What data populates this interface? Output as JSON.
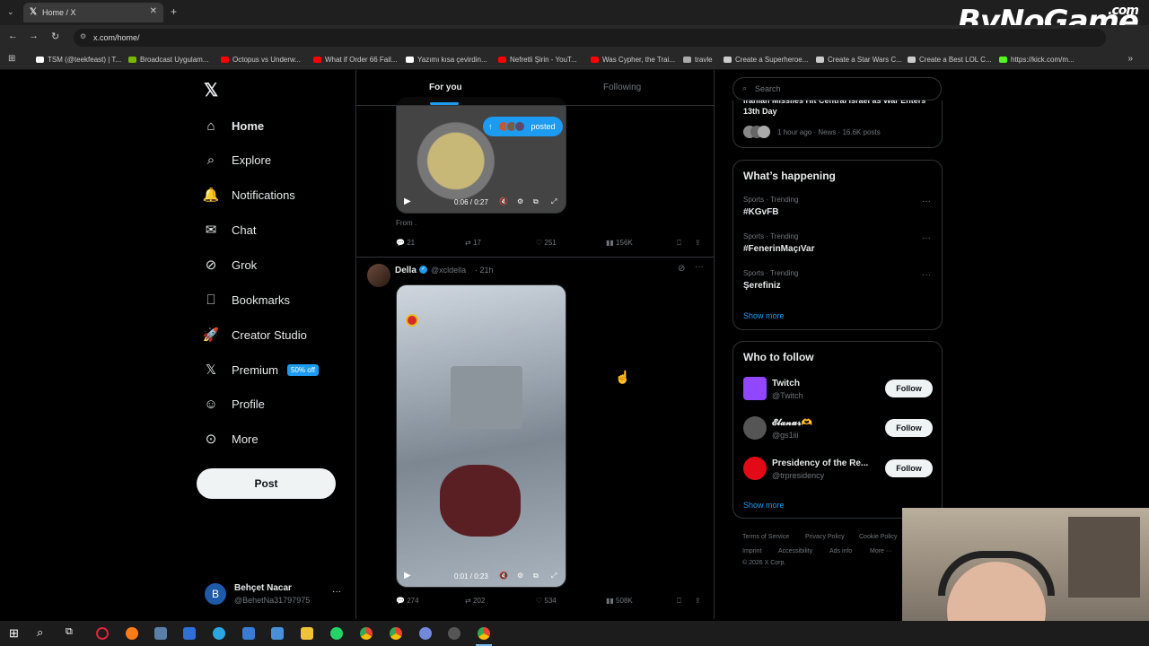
{
  "browser": {
    "tab_title": "Home / X",
    "url": "x.com/home/",
    "bookmarks": [
      {
        "label": "TSM (@teekfeast) | T...",
        "color": "#ffffff"
      },
      {
        "label": "Broadcast Uygulam...",
        "color": "#76b900"
      },
      {
        "label": "Octopus vs Underw...",
        "color": "#ff0000"
      },
      {
        "label": "What if Order 66 Fail...",
        "color": "#ff0000"
      },
      {
        "label": "Yazımı kısa çevirdin...",
        "color": "#ffffff"
      },
      {
        "label": "Nefretli Şirin - YouT...",
        "color": "#ff0000"
      },
      {
        "label": "Was Cypher, the Trai...",
        "color": "#ff0000"
      },
      {
        "label": "travle",
        "color": "#aaaaaa"
      },
      {
        "label": "Create a Superheroe...",
        "color": "#cccccc"
      },
      {
        "label": "Create a Star Wars C...",
        "color": "#cccccc"
      },
      {
        "label": "Create a Best LOL C...",
        "color": "#cccccc"
      },
      {
        "label": "https://kick.com/m...",
        "color": "#53fc18"
      }
    ],
    "watermark": "ByNoGame",
    "watermark_suffix": ".com"
  },
  "nav": {
    "logo": "X",
    "items": [
      {
        "label": "Home",
        "icon": "home-icon"
      },
      {
        "label": "Explore",
        "icon": "search-icon"
      },
      {
        "label": "Notifications",
        "icon": "bell-icon"
      },
      {
        "label": "Chat",
        "icon": "mail-icon"
      },
      {
        "label": "Grok",
        "icon": "grok-icon"
      },
      {
        "label": "Bookmarks",
        "icon": "bookmark-icon"
      },
      {
        "label": "Creator Studio",
        "icon": "rocket-icon"
      },
      {
        "label": "Premium",
        "icon": "x-icon"
      },
      {
        "label": "Profile",
        "icon": "person-icon"
      },
      {
        "label": "More",
        "icon": "more-icon"
      }
    ],
    "premium_badge": "50% off",
    "post_label": "Post",
    "account": {
      "name": "Behçet Nacar",
      "handle": "@BehetNa31797975",
      "initial": "B"
    }
  },
  "feed": {
    "tabs": [
      "For you",
      "Following"
    ],
    "posted_pill": "posted",
    "post1": {
      "video_time": "0:06 / 0:27",
      "from_text": "From .",
      "replies": "21",
      "reposts": "17",
      "likes": "251",
      "views": "156K"
    },
    "post2": {
      "author": "Della",
      "handle": "@xcldella",
      "time": "· 21h",
      "video_time": "0:01 / 0:23",
      "replies": "274",
      "reposts": "202",
      "likes": "534",
      "views": "508K"
    }
  },
  "sidebar": {
    "search_placeholder": "Search",
    "news": {
      "title": "Iranian Missiles Hit Central Israel as War Enters 13th Day",
      "meta": "1 hour ago · News · 16.6K posts"
    },
    "happening_title": "What’s happening",
    "trends": [
      {
        "meta": "Sports · Trending",
        "tag": "#KGvFB"
      },
      {
        "meta": "Sports · Trending",
        "tag": "#FenerinMaçıVar"
      },
      {
        "meta": "Sports · Trending",
        "tag": "Şerefiniz"
      }
    ],
    "show_more": "Show more",
    "who_title": "Who to follow",
    "who": [
      {
        "name": "Twitch",
        "handle": "@Twitch",
        "color": "#9146ff"
      },
      {
        "name": "𝓔𝓵𝓪𝓷𝓾𝓻🫶",
        "handle": "@gs1iii",
        "color": "#555555"
      },
      {
        "name": "Presidency of the Re...",
        "handle": "@trpresidency",
        "color": "#e30a17"
      }
    ],
    "follow_label": "Follow",
    "footer": [
      "Terms of Service",
      "Privacy Policy",
      "Cookie Policy",
      "Imprint",
      "Accessibility",
      "Ads info",
      "More ···",
      "© 2026 X Corp."
    ]
  },
  "colors": {
    "accent": "#1d9bf0",
    "background": "#000000",
    "border": "#2f3336"
  }
}
